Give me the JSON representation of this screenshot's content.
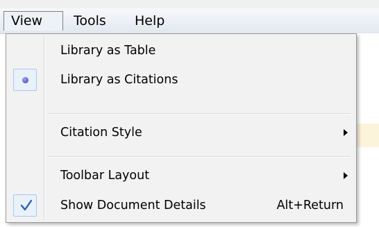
{
  "menubar": {
    "items": [
      {
        "label": "View"
      },
      {
        "label": "Tools"
      },
      {
        "label": "Help"
      }
    ]
  },
  "view_menu": {
    "items": [
      {
        "label": "Library as Table",
        "shortcut": "",
        "submenu": false,
        "state": "none"
      },
      {
        "label": "Library as Citations",
        "shortcut": "",
        "submenu": false,
        "state": "radio-selected"
      },
      {
        "label": "Citation Style",
        "shortcut": "",
        "submenu": true,
        "state": "none"
      },
      {
        "label": "Toolbar Layout",
        "shortcut": "",
        "submenu": true,
        "state": "none"
      },
      {
        "label": "Show Document Details",
        "shortcut": "Alt+Return",
        "submenu": false,
        "state": "checked"
      }
    ]
  },
  "colors": {
    "radio": "#3a3f9a",
    "check": "#2a5fb8"
  }
}
